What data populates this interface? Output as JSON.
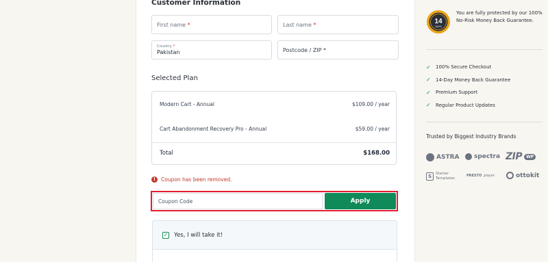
{
  "customer": {
    "title": "Customer Information",
    "first_name_placeholder": "First name",
    "last_name_placeholder": "Last name",
    "country_label": "Country",
    "country_value": "Pakistan",
    "postcode_placeholder": "Postcode / ZIP",
    "required_mark": "*"
  },
  "plan": {
    "title": "Selected Plan",
    "items": [
      {
        "name": "Modern Cart - Annual",
        "price": "$109.00 / year"
      },
      {
        "name": "Cart Abandonment Recovery Pro - Annual",
        "price": "$59.00 / year"
      }
    ],
    "total_label": "Total",
    "total_value": "$168.00"
  },
  "coupon": {
    "message": "Coupon has been removed.",
    "placeholder": "Coupon Code",
    "apply_label": "Apply"
  },
  "upsell": {
    "label": "Yes, I will take it!",
    "checked": true
  },
  "sidebar": {
    "badge_number": "14",
    "badge_text": "DAYS",
    "guarantee_text": "You are fully protected by our 100% No-Risk Money Back Guarantee.",
    "features": [
      "100% Secure Checkout",
      "14-Day Money Back Guarantee",
      "Premium Support",
      "Regular Product Updates"
    ],
    "trusted_title": "Trusted by Biggest Industry Brands",
    "brands": {
      "astra": "ASTRA",
      "spectra": "spectra",
      "zip": "ZIP",
      "wp": "WP",
      "starter_line1": "Starter",
      "starter_line2": "Templates",
      "presto": "PRESTO",
      "presto_sub": "player",
      "ottokit": "ottokit"
    }
  },
  "colors": {
    "accent": "#0f8a58",
    "error": "#c0392b",
    "highlight": "#e11d2e",
    "badge_gold": "#e8a317",
    "page_bg": "#f8f6f1"
  }
}
